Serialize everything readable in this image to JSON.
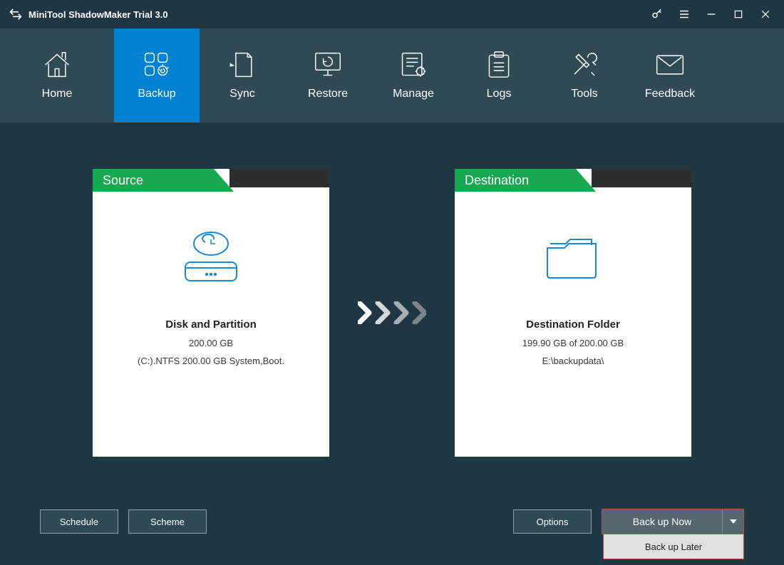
{
  "titlebar": {
    "title": "MiniTool ShadowMaker Trial 3.0"
  },
  "nav": [
    {
      "key": "home",
      "label": "Home"
    },
    {
      "key": "backup",
      "label": "Backup"
    },
    {
      "key": "sync",
      "label": "Sync"
    },
    {
      "key": "restore",
      "label": "Restore"
    },
    {
      "key": "manage",
      "label": "Manage"
    },
    {
      "key": "logs",
      "label": "Logs"
    },
    {
      "key": "tools",
      "label": "Tools"
    },
    {
      "key": "feedback",
      "label": "Feedback"
    }
  ],
  "nav_active": "backup",
  "source": {
    "tab": "Source",
    "heading": "Disk and Partition",
    "size": "200.00 GB",
    "detail": "(C:).NTFS 200.00 GB System,Boot."
  },
  "destination": {
    "tab": "Destination",
    "heading": "Destination Folder",
    "size": "199.90 GB of 200.00 GB",
    "detail": "E:\\backupdata\\"
  },
  "buttons": {
    "schedule": "Schedule",
    "scheme": "Scheme",
    "options": "Options",
    "backup_now": "Back up Now",
    "backup_later": "Back up Later"
  }
}
